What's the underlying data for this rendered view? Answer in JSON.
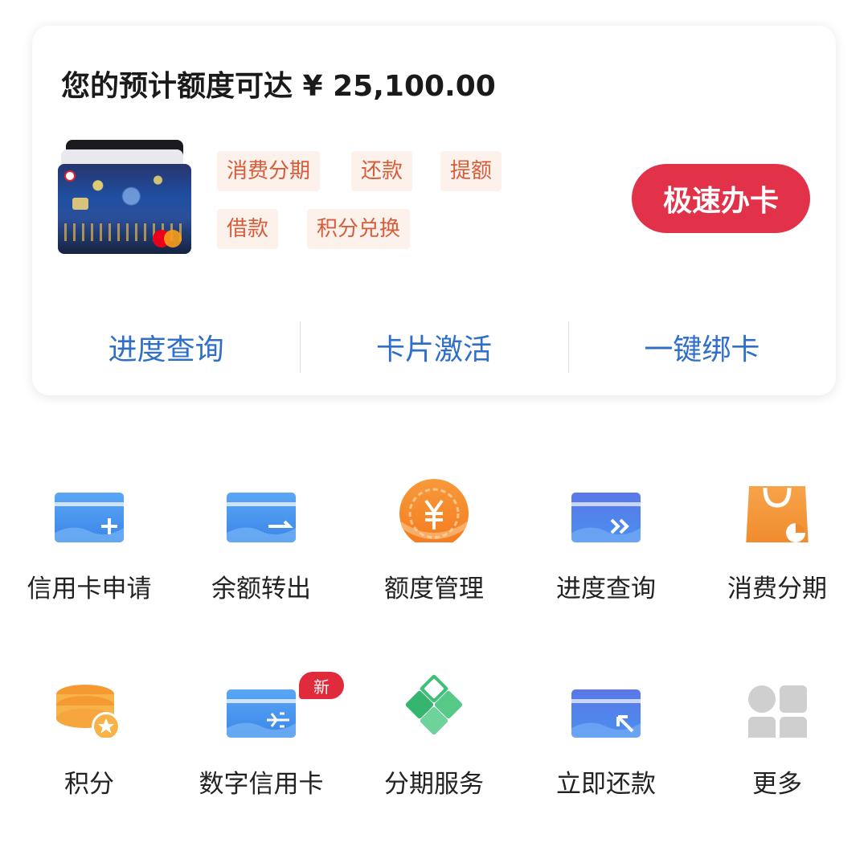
{
  "card": {
    "headline": "您的预计额度可达 ¥ 25,100.00",
    "tags": [
      "消费分期",
      "还款",
      "提额",
      "借款",
      "积分兑换"
    ],
    "apply_button": "极速办卡",
    "links": [
      "进度查询",
      "卡片激活",
      "一键绑卡"
    ]
  },
  "grid": {
    "items": [
      {
        "label": "信用卡申请",
        "icon": "card-plus-icon"
      },
      {
        "label": "余额转出",
        "icon": "card-transfer-out-icon"
      },
      {
        "label": "额度管理",
        "icon": "yuan-coin-icon"
      },
      {
        "label": "进度查询",
        "icon": "card-progress-icon"
      },
      {
        "label": "消费分期",
        "icon": "shopping-bag-icon"
      },
      {
        "label": "积分",
        "icon": "points-star-icon"
      },
      {
        "label": "数字信用卡",
        "icon": "digital-card-icon",
        "badge": "新"
      },
      {
        "label": "分期服务",
        "icon": "diamond-tiles-icon"
      },
      {
        "label": "立即还款",
        "icon": "card-repay-icon"
      },
      {
        "label": "更多",
        "icon": "more-grid-icon"
      }
    ]
  },
  "colors": {
    "accent_red": "#e2324a",
    "link_blue": "#2f6fc8",
    "tag_text": "#d75d3a",
    "tag_bg": "#fdf1ec"
  }
}
